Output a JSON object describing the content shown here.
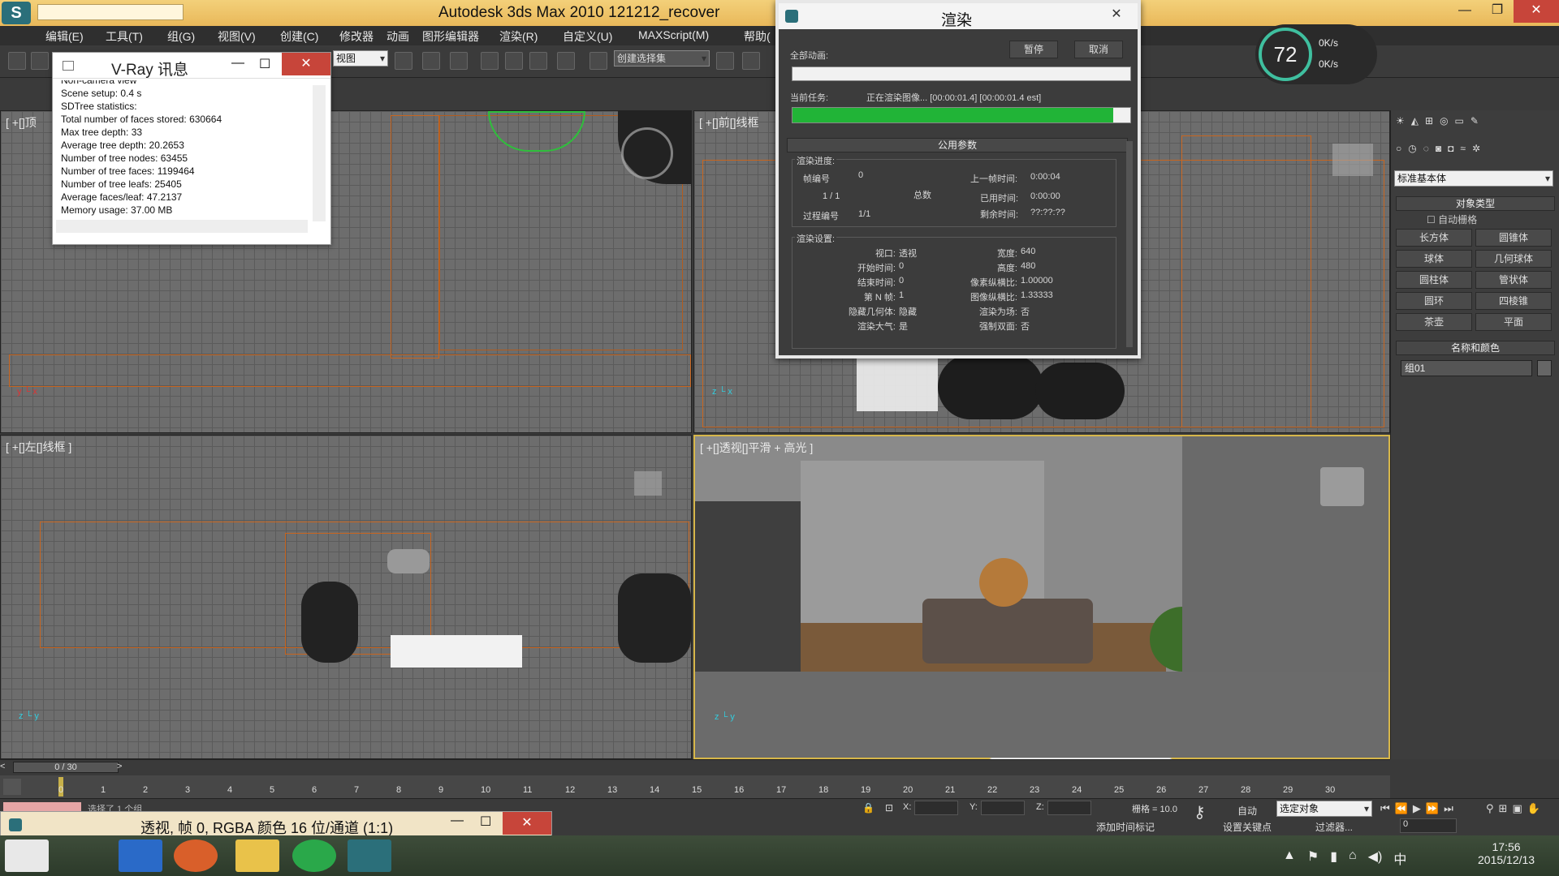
{
  "titlebar": {
    "title": "Autodesk 3ds Max  2010       121212_recover"
  },
  "menu": [
    "编辑(E)",
    "工具(T)",
    "组(G)",
    "视图(V)",
    "创建(C)",
    "修改器",
    "动画",
    "图形编辑器",
    "渲染(R)",
    "自定义(U)",
    "MAXScript(M)",
    "帮助("
  ],
  "toolbar": {
    "view_dropdown": "视图",
    "selection_set": "创建选择集"
  },
  "viewports": {
    "top": "[ +[]顶",
    "front": "[ +[]前[]线框",
    "left": "[ +[]左[]线框 ]",
    "persp": "[ +[]透视[]平滑 + 高光 ]"
  },
  "vray": {
    "title": "V-Ray 讯息",
    "lines": [
      "Non-camera view",
      "Scene setup: 0.4 s",
      "SDTree statistics:",
      "Total number of faces stored: 630664",
      "Max tree depth: 33",
      "Average tree depth: 20.2653",
      "Number of tree nodes: 63455",
      "Number of tree faces: 1199464",
      "Number of tree leafs: 25405",
      "Average faces/leaf: 47.2137",
      "Memory usage: 37.00 MB"
    ]
  },
  "render": {
    "title": "渲染",
    "all_anim_label": "全部动画:",
    "pause": "暂停",
    "cancel": "取消",
    "current_task_label": "当前任务:",
    "current_task": "正在渲染图像... [00:00:01.4] [00:00:01.4 est]",
    "progress": 0.95,
    "common_params": "公用参数",
    "progress_group": "渲染进度:",
    "frame_no_label": "帧编号",
    "frame_no": "0",
    "frame_count": "1   /  1",
    "total_label": "总数",
    "pass_label": "过程编号",
    "pass": "1/1",
    "last_frame_time_label": "上一帧时间:",
    "last_frame_time": "0:00:04",
    "elapsed_label": "已用时间:",
    "elapsed": "0:00:00",
    "remaining_label": "剩余时间:",
    "remaining": "??:??:??",
    "settings_group": "渲染设置:",
    "settings": [
      {
        "k": "视口:",
        "v": "透视",
        "k2": "宽度:",
        "v2": "640"
      },
      {
        "k": "开始时间:",
        "v": "0",
        "k2": "高度:",
        "v2": "480"
      },
      {
        "k": "结束时间:",
        "v": "0",
        "k2": "像素纵横比:",
        "v2": "1.00000"
      },
      {
        "k": "第 N 帧:",
        "v": "1",
        "k2": "图像纵横比:",
        "v2": "1.33333"
      },
      {
        "k": "隐藏几何体:",
        "v": "隐藏",
        "k2": "渲染为场:",
        "v2": "否"
      },
      {
        "k": "渲染大气:",
        "v": "是",
        "k2": "强制双面:",
        "v2": "否"
      }
    ]
  },
  "speed": {
    "percent": "72",
    "up": "0K/s",
    "down": "0K/s"
  },
  "cmdpanel": {
    "category": "标准基本体",
    "object_type": "对象类型",
    "autogrid": "自动栅格",
    "buttons": [
      "长方体",
      "圆锥体",
      "球体",
      "几何球体",
      "圆柱体",
      "管状体",
      "圆环",
      "四棱锥",
      "茶壶",
      "平面"
    ],
    "name_color": "名称和颜色",
    "name_value": "组01"
  },
  "timeline": {
    "slider": "0 / 30",
    "ticks": [
      "0",
      "1",
      "2",
      "3",
      "4",
      "5",
      "6",
      "7",
      "8",
      "9",
      "10",
      "11",
      "12",
      "13",
      "14",
      "15",
      "16",
      "17",
      "18",
      "19",
      "20",
      "21",
      "22",
      "23",
      "24",
      "25",
      "26",
      "27",
      "28",
      "29",
      "30"
    ]
  },
  "status": {
    "selected": "选择了 1 个组",
    "x": "X:",
    "y": "Y:",
    "z": "Z:",
    "grid": "栅格 = 10.0",
    "auto": "自动",
    "selected_obj": "选定对象",
    "set_key": "设置关键点",
    "filter": "过滤器...",
    "add_time_tag": "添加时间标记",
    "frame": "0"
  },
  "framebuffer": {
    "title": "透视, 帧 0, RGBA 颜色 16 位/通道 (1:1)"
  },
  "taskbar": {
    "time": "17:56",
    "date": "2015/12/13",
    "ime": "中"
  }
}
